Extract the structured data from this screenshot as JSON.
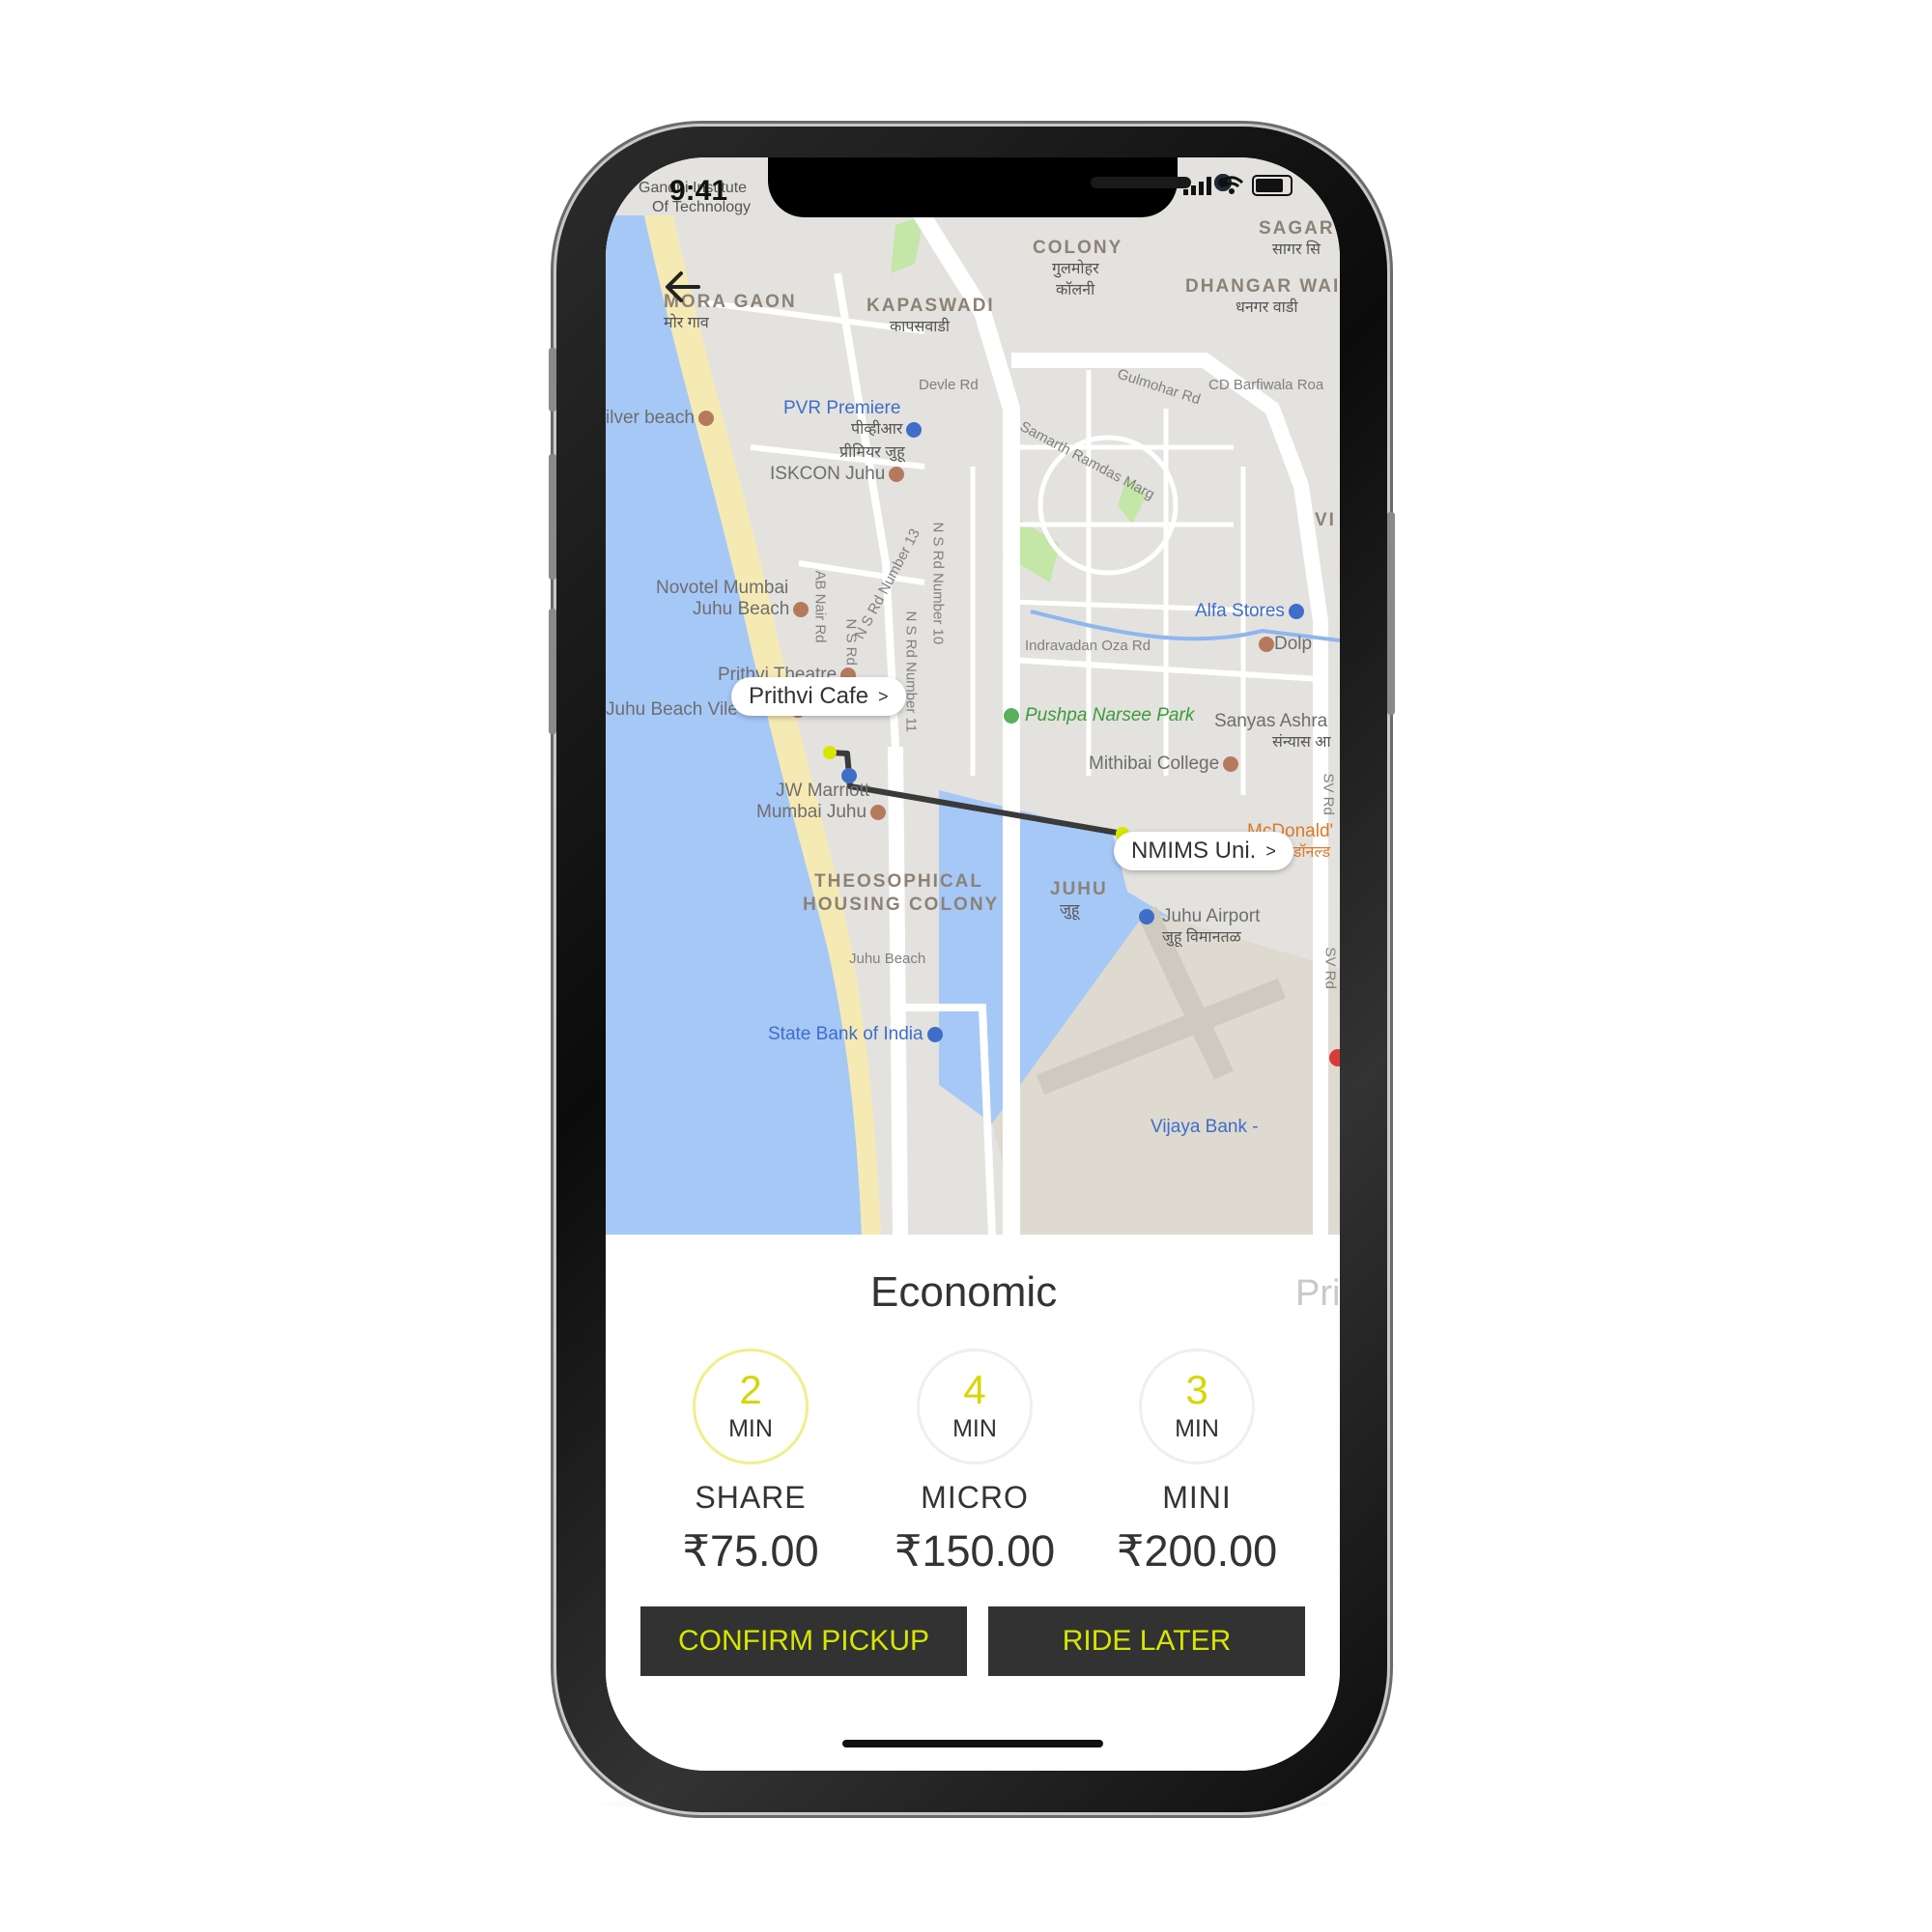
{
  "status_bar": {
    "time": "9:41"
  },
  "map": {
    "labels": {
      "gandhi_institute_line1": "Gandhi Institute",
      "gandhi_institute_line2": "Of Technology",
      "colony": "COLONY",
      "colony_hi1": "गुलमोहर",
      "colony_hi2": "कॉलनी",
      "sagar": "SAGAR C",
      "sagar_hi": "सागर सि",
      "mora_gaon": "MORA GAON",
      "mora_gaon_hi": "मोर गाव",
      "kapaswadi": "KAPASWADI",
      "kapaswadi_hi": "कापसवाडी",
      "dhangar_wadi": "DHANGAR WAI",
      "dhangar_wadi_hi": "धनगर वाडी",
      "devle_rd": "Devle Rd",
      "cd_barfiwala": "CD Barfiwala Roa",
      "gulmohar_rd": "Gulmohar Rd",
      "samarth_ramdas": "Samarth Ramdas Marg",
      "silver_beach": "ilver beach",
      "pvr_premiere": "PVR Premiere",
      "pvr_hi1": "पीव्हीआर",
      "pvr_hi2": "प्रीमियर जुहू",
      "iskcon_juhu": "ISKCON Juhu",
      "vi": "VI",
      "ab_nair_rd": "AB Nair Rd",
      "ns_rd_13": "N S Rd Number 13",
      "ns_rd_10": "N S Rd Number 10",
      "ns_rd_11": "N S Rd Number 11",
      "n_s_rd": "N S Rd",
      "novotel_line1": "Novotel Mumbai",
      "novotel_line2": "Juhu Beach",
      "alfa_stores": "Alfa Stores",
      "dolp": "Dolp",
      "indravadan_oza": "Indravadan Oza Rd",
      "prithvi_theatre": "Prithvi Theatre",
      "juhu_beach_vile_parle": "Juhu Beach Vile Parle",
      "pushpa_narsee_park": "Pushpa Narsee Park",
      "sanyas_ashram": "Sanyas Ashra",
      "sanyas_hi": "संन्यास आ",
      "mithibai_college": "Mithibai College",
      "sv_rd": "SV Rd",
      "jw_marriott_line1": "JW Marriott",
      "jw_marriott_line2": "Mumbai Juhu",
      "mcdonalds": "McDonald'",
      "mcdonalds_hi": "मॅकडॉनल्ड",
      "theosophical_line1": "THEOSOPHICAL",
      "theosophical_line2": "HOUSING COLONY",
      "juhu": "JUHU",
      "juhu_hi": "जुहू",
      "juhu_airport": "Juhu Airport",
      "juhu_airport_hi": "जुहू विमानतळ",
      "juhu_beach": "Juhu Beach",
      "sv_rd_2": "SV Rd",
      "state_bank": "State Bank of India",
      "vijaya_bank": "Vijaya Bank -"
    },
    "pickup_pill": "Prithvi Cafe",
    "drop_pill": "NMIMS Uni.",
    "pill_chevron": ">",
    "colors": {
      "water": "#a6c8f7",
      "land": "#e4e2de",
      "road": "#ffffff",
      "park": "#c4e6a6",
      "route": "#3a3a3a",
      "marker": "#d6e600"
    }
  },
  "sheet": {
    "category_title": "Economic",
    "next_category_peek": "Pri",
    "rides": [
      {
        "eta_value": "2",
        "eta_unit": "MIN",
        "name": "SHARE",
        "price": "₹75.00",
        "selected": true
      },
      {
        "eta_value": "4",
        "eta_unit": "MIN",
        "name": "MICRO",
        "price": "₹150.00",
        "selected": false
      },
      {
        "eta_value": "3",
        "eta_unit": "MIN",
        "name": "MINI",
        "price": "₹200.00",
        "selected": false
      }
    ],
    "confirm_label": "CONFIRM PICKUP",
    "ride_later_label": "RIDE LATER"
  }
}
